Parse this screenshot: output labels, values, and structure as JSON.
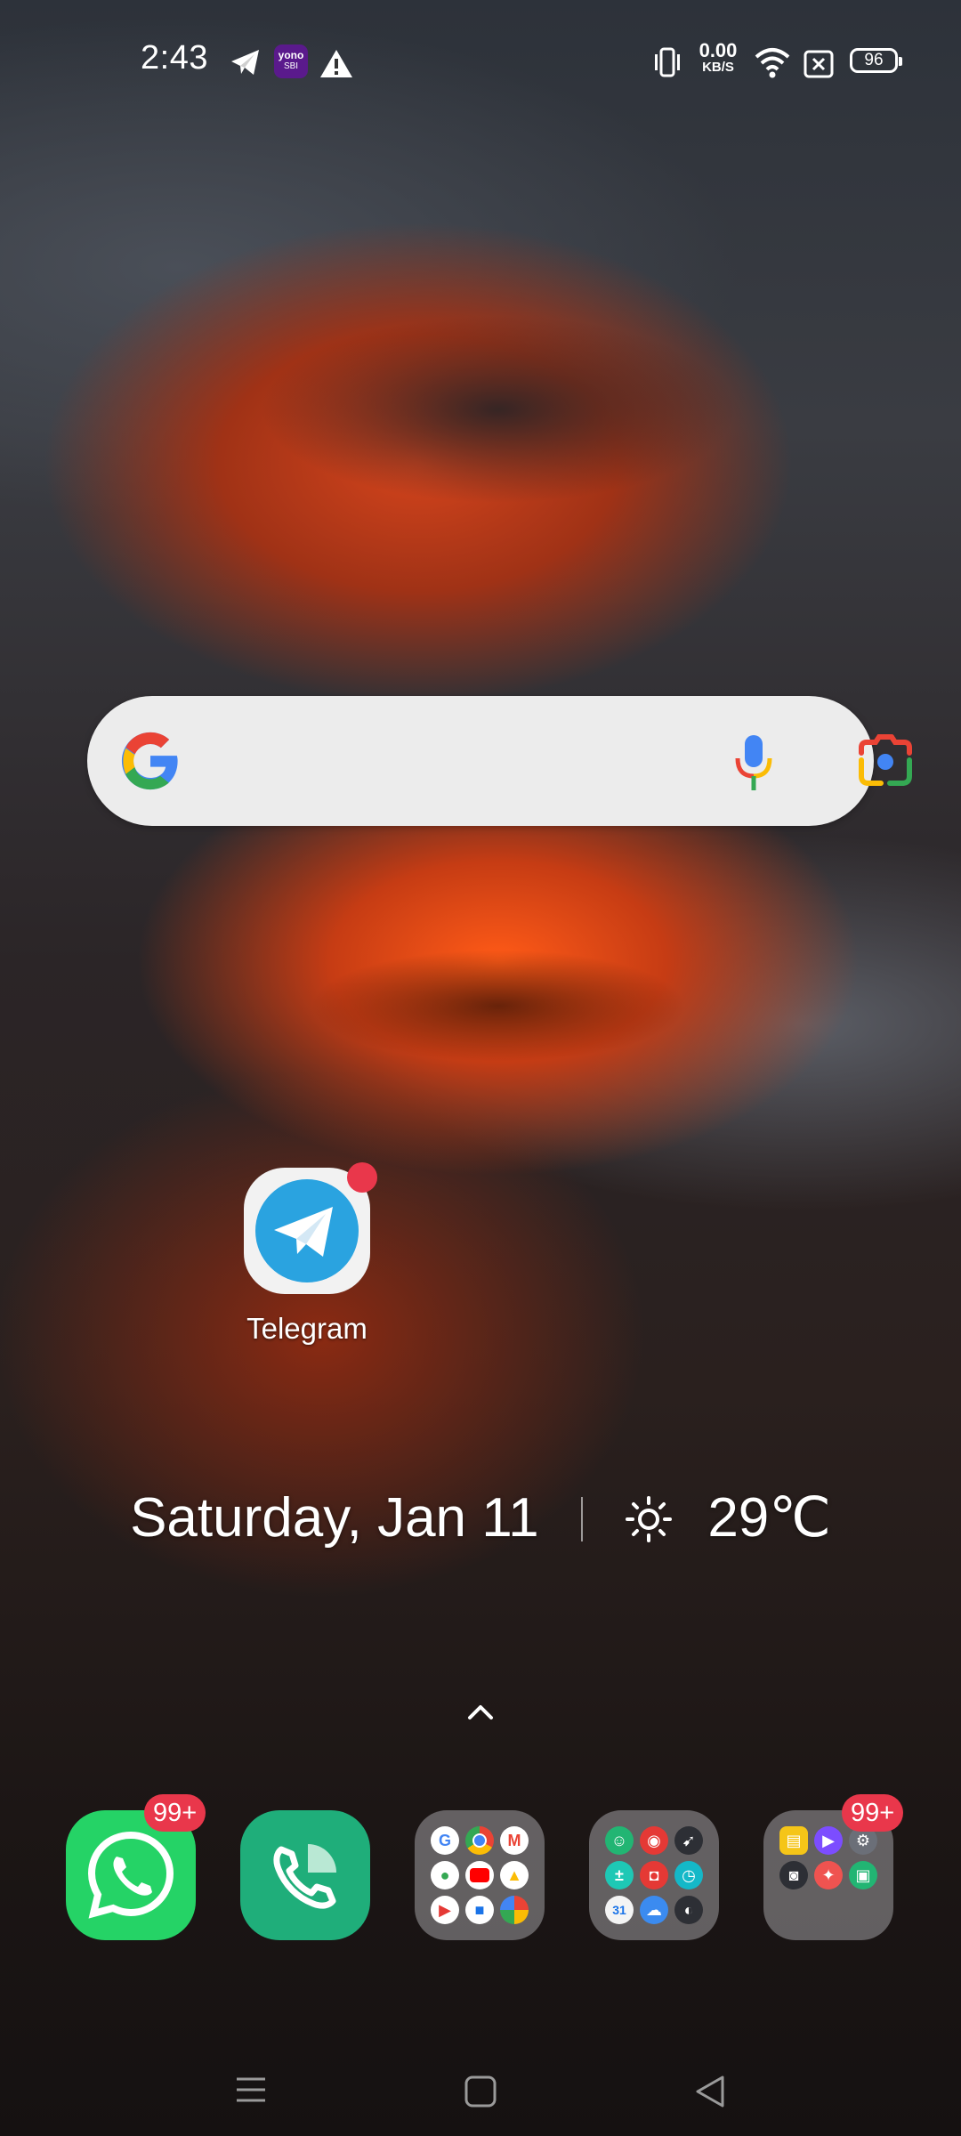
{
  "status_bar": {
    "time": "2:43",
    "net_speed_value": "0.00",
    "net_speed_unit": "KB/S",
    "battery_level": "96",
    "icons": [
      "telegram-icon",
      "yono-sbi-icon",
      "warning-icon",
      "vibrate-icon",
      "wifi-icon",
      "no-sim-icon",
      "battery-icon"
    ],
    "yono_text": "yono",
    "sbi_text": "SBI"
  },
  "search_widget": {
    "icons": [
      "google-logo-icon",
      "microphone-icon",
      "google-lens-icon"
    ]
  },
  "home_apps": [
    {
      "label": "Telegram",
      "icon": "telegram-icon",
      "has_notification_dot": true
    }
  ],
  "date_weather": {
    "date": "Saturday, Jan 11",
    "temperature": "29℃",
    "weather_icon": "sun-icon"
  },
  "dock": {
    "whatsapp_badge": "99+",
    "folder3_badge": "99+",
    "items": [
      "whatsapp-icon",
      "phone-icon",
      "google-apps-folder",
      "tools-folder",
      "misc-folder"
    ]
  },
  "nav_bar": {
    "buttons": [
      "menu-button",
      "home-button",
      "back-button"
    ]
  },
  "colors": {
    "badge_red": "#e9374b",
    "telegram_blue": "#2aa3e0",
    "whatsapp_green": "#25d366",
    "phone_green": "#1fae7a"
  }
}
